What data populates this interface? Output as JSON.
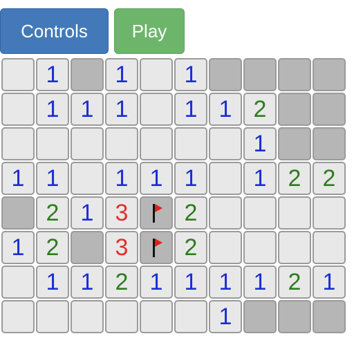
{
  "toolbar": {
    "controls_label": "Controls",
    "play_label": "Play",
    "colors": {
      "controls": "#4379b8",
      "play": "#6db56b"
    }
  },
  "board": {
    "rows": 8,
    "cols": 10,
    "legend": "R = revealed empty, H = hidden, F = flag, digit = revealed number",
    "number_colors": {
      "1": "#1a2fd4",
      "2": "#2e7d1e",
      "3": "#e03030"
    },
    "grid": [
      [
        "R",
        "1",
        "H",
        "1",
        "R",
        "1",
        "H",
        "H",
        "H",
        "H"
      ],
      [
        "R",
        "1",
        "1",
        "1",
        "R",
        "1",
        "1",
        "2",
        "H",
        "H"
      ],
      [
        "R",
        "R",
        "R",
        "R",
        "R",
        "R",
        "R",
        "1",
        "H",
        "H"
      ],
      [
        "1",
        "1",
        "R",
        "1",
        "1",
        "1",
        "R",
        "1",
        "2",
        "2"
      ],
      [
        "H",
        "2",
        "1",
        "3",
        "F",
        "2",
        "R",
        "R",
        "R",
        "R"
      ],
      [
        "1",
        "2",
        "H",
        "3",
        "F",
        "2",
        "R",
        "R",
        "R",
        "R"
      ],
      [
        "R",
        "1",
        "1",
        "2",
        "1",
        "1",
        "1",
        "1",
        "2",
        "1"
      ],
      [
        "R",
        "R",
        "R",
        "R",
        "R",
        "R",
        "1",
        "H",
        "H",
        "H"
      ]
    ]
  }
}
